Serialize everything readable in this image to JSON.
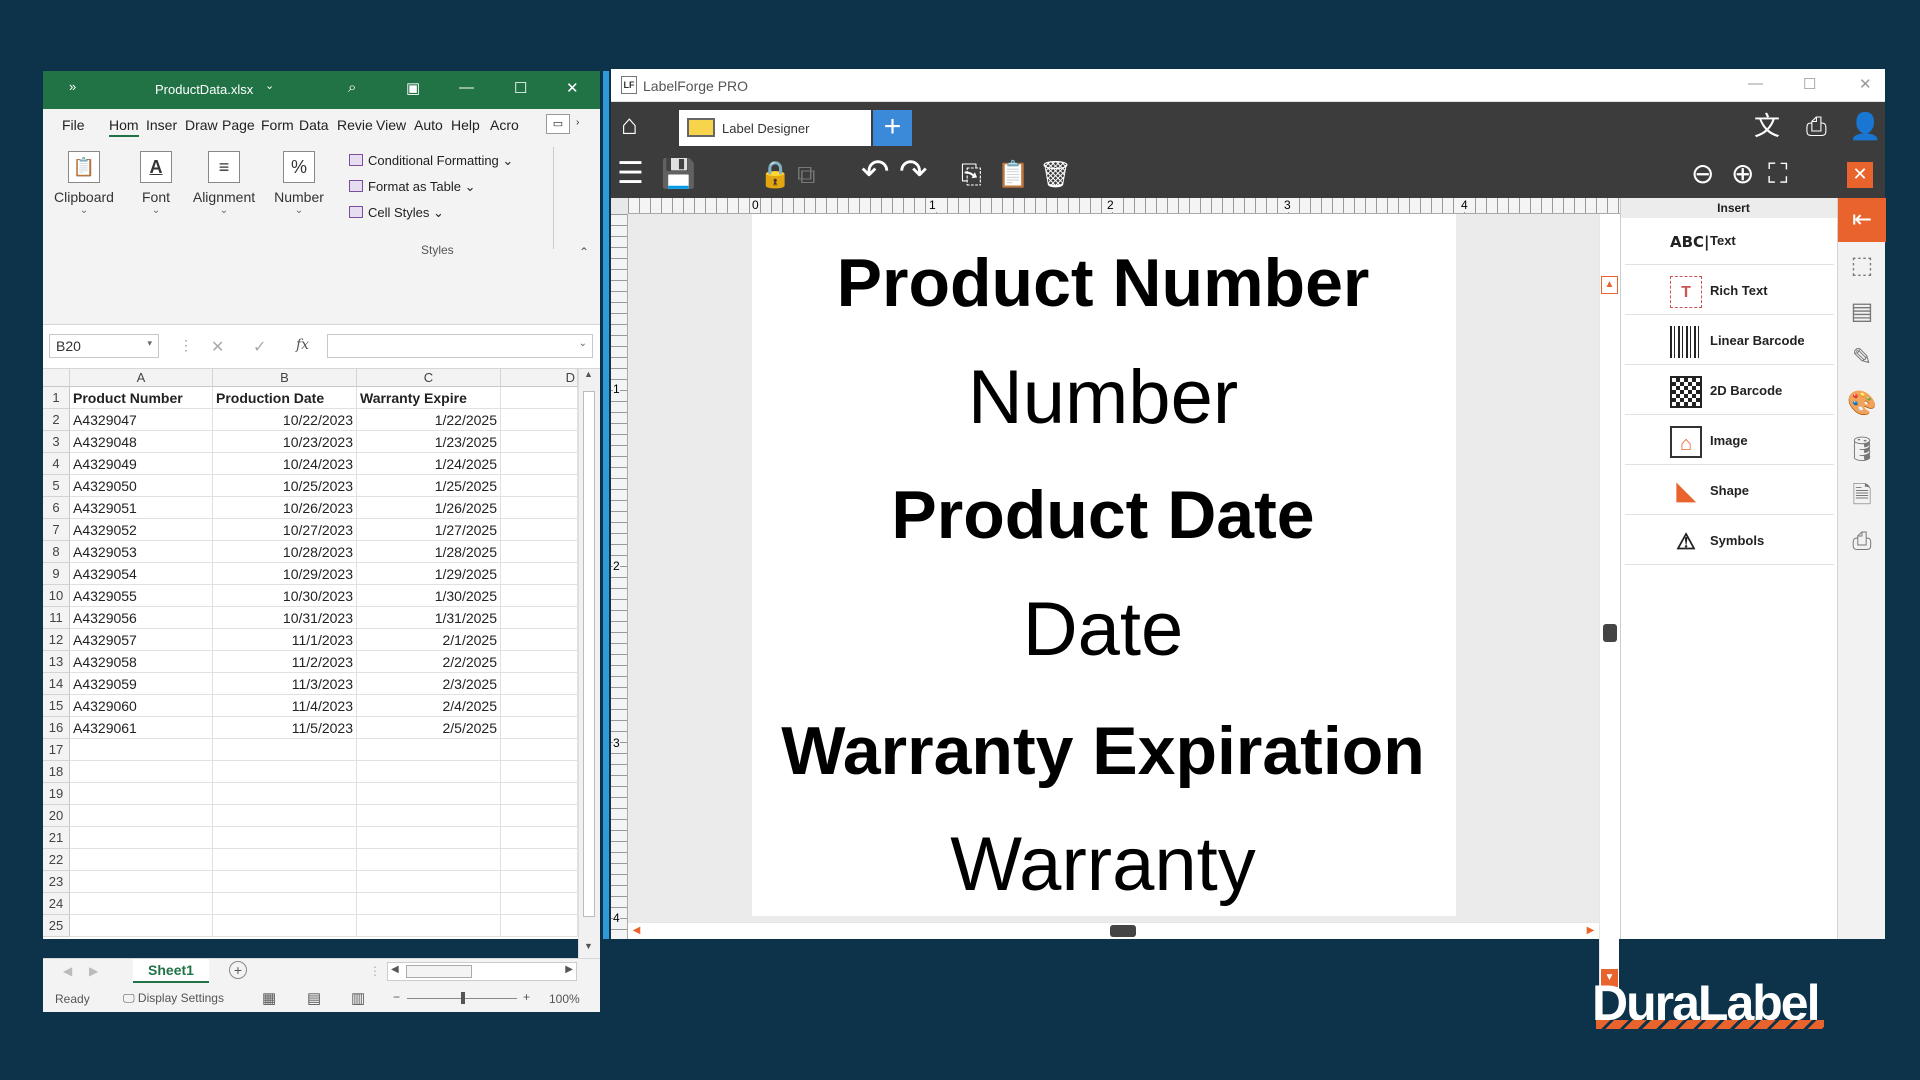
{
  "excel": {
    "title": "ProductData.xlsx",
    "menu": [
      "File",
      "Hom",
      "Inser",
      "Draw",
      "Page",
      "Form",
      "Data",
      "Revie",
      "View",
      "Auto",
      "Help",
      "Acro"
    ],
    "ribbon": {
      "clipboard": "Clipboard",
      "font": "Font",
      "alignment": "Alignment",
      "number": "Number",
      "conditional_formatting": "Conditional Formatting",
      "format_as_table": "Format as Table",
      "cell_styles": "Cell Styles",
      "styles_group": "Styles"
    },
    "name_box": "B20",
    "fx": "fx",
    "columns": [
      "A",
      "B",
      "C",
      "D"
    ],
    "rows": [
      {
        "n": "1",
        "a": "Product Number",
        "b": "Production Date",
        "c": "Warranty Expire"
      },
      {
        "n": "2",
        "a": "A4329047",
        "b": "10/22/2023",
        "c": "1/22/2025"
      },
      {
        "n": "3",
        "a": "A4329048",
        "b": "10/23/2023",
        "c": "1/23/2025"
      },
      {
        "n": "4",
        "a": "A4329049",
        "b": "10/24/2023",
        "c": "1/24/2025"
      },
      {
        "n": "5",
        "a": "A4329050",
        "b": "10/25/2023",
        "c": "1/25/2025"
      },
      {
        "n": "6",
        "a": "A4329051",
        "b": "10/26/2023",
        "c": "1/26/2025"
      },
      {
        "n": "7",
        "a": "A4329052",
        "b": "10/27/2023",
        "c": "1/27/2025"
      },
      {
        "n": "8",
        "a": "A4329053",
        "b": "10/28/2023",
        "c": "1/28/2025"
      },
      {
        "n": "9",
        "a": "A4329054",
        "b": "10/29/2023",
        "c": "1/29/2025"
      },
      {
        "n": "10",
        "a": "A4329055",
        "b": "10/30/2023",
        "c": "1/30/2025"
      },
      {
        "n": "11",
        "a": "A4329056",
        "b": "10/31/2023",
        "c": "1/31/2025"
      },
      {
        "n": "12",
        "a": "A4329057",
        "b": "11/1/2023",
        "c": "2/1/2025"
      },
      {
        "n": "13",
        "a": "A4329058",
        "b": "11/2/2023",
        "c": "2/2/2025"
      },
      {
        "n": "14",
        "a": "A4329059",
        "b": "11/3/2023",
        "c": "2/3/2025"
      },
      {
        "n": "15",
        "a": "A4329060",
        "b": "11/4/2023",
        "c": "2/4/2025"
      },
      {
        "n": "16",
        "a": "A4329061",
        "b": "11/5/2023",
        "c": "2/5/2025"
      },
      {
        "n": "17",
        "a": "",
        "b": "",
        "c": ""
      },
      {
        "n": "18",
        "a": "",
        "b": "",
        "c": ""
      },
      {
        "n": "19",
        "a": "",
        "b": "",
        "c": ""
      },
      {
        "n": "20",
        "a": "",
        "b": "",
        "c": ""
      },
      {
        "n": "21",
        "a": "",
        "b": "",
        "c": ""
      },
      {
        "n": "22",
        "a": "",
        "b": "",
        "c": ""
      },
      {
        "n": "23",
        "a": "",
        "b": "",
        "c": ""
      },
      {
        "n": "24",
        "a": "",
        "b": "",
        "c": ""
      },
      {
        "n": "25",
        "a": "",
        "b": "",
        "c": ""
      }
    ],
    "sheet_tab": "Sheet1",
    "status": "Ready",
    "display_settings": "Display Settings",
    "zoom": "100%"
  },
  "labelforge": {
    "title": "LabelForge PRO",
    "tab": "Label Designer",
    "ruler_h": [
      "0",
      "1",
      "2",
      "3",
      "4"
    ],
    "ruler_v": [
      "1",
      "2",
      "3",
      "4"
    ],
    "label_lines": [
      {
        "text": "Product Number",
        "bold": true
      },
      {
        "text": "Number",
        "bold": false
      },
      {
        "text": "Product Date",
        "bold": true
      },
      {
        "text": "Date",
        "bold": false
      },
      {
        "text": "Warranty Expiration",
        "bold": true
      },
      {
        "text": "Warranty",
        "bold": false
      }
    ],
    "insert_panel": {
      "header": "Insert",
      "items": [
        "Text",
        "Rich Text",
        "Linear Barcode",
        "2D Barcode",
        "Image",
        "Shape",
        "Symbols"
      ]
    },
    "accent": "#e8642c"
  },
  "brand": {
    "logo": "DuraLabel"
  }
}
